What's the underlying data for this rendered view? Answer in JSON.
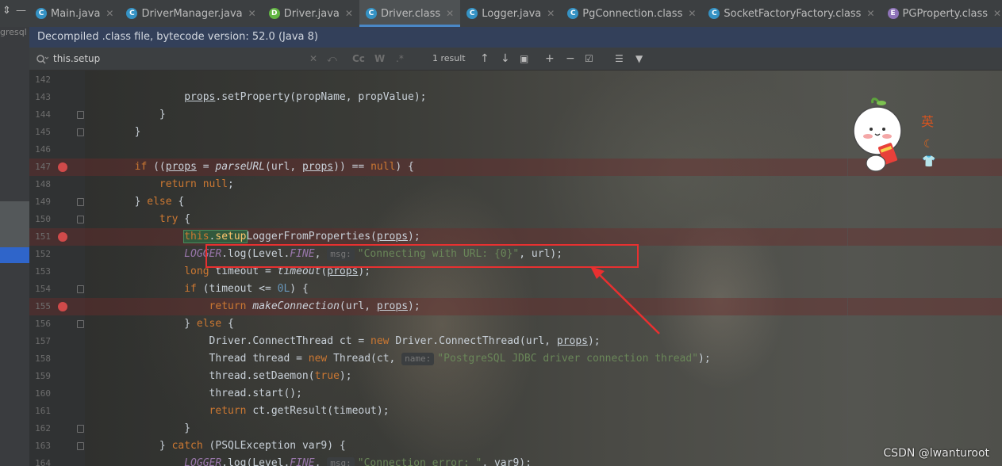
{
  "left_panel": {
    "project_text": "gresql"
  },
  "tabs": [
    {
      "label": "Main.java",
      "icon": "C",
      "icon_name": "class-icon"
    },
    {
      "label": "DriverManager.java",
      "icon": "C",
      "icon_name": "class-icon"
    },
    {
      "label": "Driver.java",
      "icon": "D",
      "icon_name": "driver-file-icon"
    },
    {
      "label": "Driver.class",
      "icon": "C",
      "icon_name": "class-icon",
      "active": true
    },
    {
      "label": "Logger.java",
      "icon": "C",
      "icon_name": "class-icon"
    },
    {
      "label": "PgConnection.class",
      "icon": "C",
      "icon_name": "class-icon"
    },
    {
      "label": "SocketFactoryFactory.class",
      "icon": "C",
      "icon_name": "class-icon"
    },
    {
      "label": "PGProperty.class",
      "icon": "E",
      "icon_name": "enum-icon"
    }
  ],
  "banner": {
    "text": "Decompiled .class file, bytecode version: 52.0 (Java 8)"
  },
  "search": {
    "query": "this.setup",
    "result_count": "1 result",
    "case_label": "Cc",
    "word_label": "W",
    "regex_label": ".*"
  },
  "editor": {
    "lines": [
      {
        "num": "142",
        "code": ""
      },
      {
        "num": "143",
        "code": "                props.setProperty(propName, propValue);"
      },
      {
        "num": "144",
        "code": "            }"
      },
      {
        "num": "145",
        "code": "        }"
      },
      {
        "num": "146",
        "code": ""
      },
      {
        "num": "147",
        "code": "        if ((props = parseURL(url, props)) == null) {",
        "breakpoint": true
      },
      {
        "num": "148",
        "code": "            return null;"
      },
      {
        "num": "149",
        "code": "        } else {"
      },
      {
        "num": "150",
        "code": "            try {"
      },
      {
        "num": "151",
        "code": "                this.setupLoggerFromProperties(props);",
        "breakpoint": true
      },
      {
        "num": "152",
        "code": "                LOGGER.log(Level.FINE, msg: \"Connecting with URL: {0}\", url);"
      },
      {
        "num": "153",
        "code": "                long timeout = timeout(props);"
      },
      {
        "num": "154",
        "code": "                if (timeout <= 0L) {"
      },
      {
        "num": "155",
        "code": "                    return makeConnection(url, props);",
        "breakpoint": true
      },
      {
        "num": "156",
        "code": "                } else {"
      },
      {
        "num": "157",
        "code": "                    Driver.ConnectThread ct = new Driver.ConnectThread(url, props);"
      },
      {
        "num": "158",
        "code": "                    Thread thread = new Thread(ct, name: \"PostgreSQL JDBC driver connection thread\");"
      },
      {
        "num": "159",
        "code": "                    thread.setDaemon(true);"
      },
      {
        "num": "160",
        "code": "                    thread.start();"
      },
      {
        "num": "161",
        "code": "                    return ct.getResult(timeout);"
      },
      {
        "num": "162",
        "code": "                }"
      },
      {
        "num": "163",
        "code": "            } catch (PSQLException var9) {"
      },
      {
        "num": "164",
        "code": "                LOGGER.log(Level.FINE, msg: \"Connection error: \", var9);"
      }
    ]
  },
  "sticker": {
    "label": "英"
  },
  "watermark": "CSDN @lwanturoot",
  "colors": {
    "keyword": "#cc7832",
    "function": "#ffc66d",
    "string": "#6a8759",
    "constant": "#9876aa",
    "number": "#6897bb",
    "breakpoint": "#d04a4a",
    "annotation": "#e83030",
    "tab_underline": "#4a88c7",
    "banner_bg": "#33405a"
  }
}
